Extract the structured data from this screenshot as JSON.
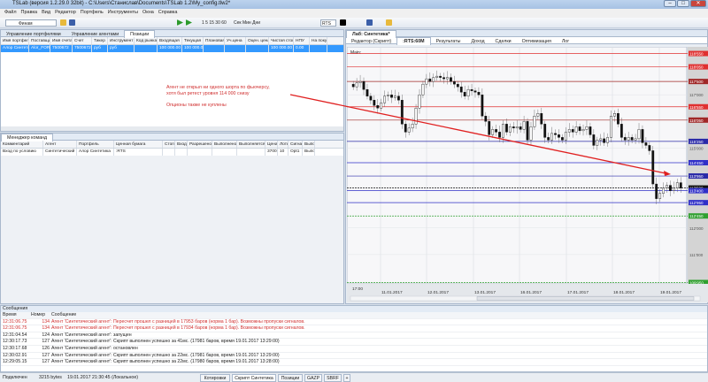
{
  "window": {
    "title": "TSLab (версия 1.2.29.0 32bit) - C:\\Users\\Станислав\\Documents\\TSLab 1.2\\My_config.tlw2*",
    "min": "–",
    "max": "□",
    "close": "✕"
  },
  "menu": [
    "Файл",
    "Правка",
    "Вид",
    "Редактор",
    "Портфель",
    "Инструменты",
    "Окна",
    "Справка"
  ],
  "toolbar": {
    "provider": "Финам",
    "intervals": "1  5  15  30  60",
    "units": "Сек  Мин  Дни",
    "symbol": "RTS"
  },
  "left_tabs": [
    "Управление портфелями",
    "Управление агентами",
    "Позиции"
  ],
  "positions": {
    "columns": [
      "Имя портфеля",
      "Поставщик",
      "Имя счета",
      "Счет",
      "Тикер",
      "Инструмент",
      "Код рынка",
      "Входящая",
      "Текущая",
      "Плановая",
      "Уч.цена",
      "Оцен. цена",
      "Чистая стоим.",
      "НПУ",
      "На покупку"
    ],
    "rows": [
      [
        "Алор Синтетика",
        "Alor_FORTS",
        "7500672",
        "7500672",
        "руб",
        "руб",
        "",
        "100 000.00",
        "100 000.00",
        "",
        "",
        "",
        "100 000.00",
        "0.00",
        ""
      ]
    ]
  },
  "commands": {
    "title": "Менеджер команд",
    "columns": [
      "Комментарий",
      "Агент",
      "Портфель",
      "Ценная бумага",
      "Стоп?",
      "Вход?",
      "Разрешено",
      "Выполнено",
      "Выполняется",
      "Цена",
      "Лоты",
      "Сигнал",
      "Выпо"
    ],
    "rows": [
      [
        "Вход по условию",
        "Синтетический",
        "Алор Синтетика",
        ":RTS",
        "",
        "",
        "",
        "",
        "",
        "3700",
        "10",
        "Opt1",
        "Выпо"
      ]
    ]
  },
  "annotation": {
    "line1": "Агент не открыл ни одного шорта по фьючерсу,",
    "line2": "хотя был ретест уровня 114 000 снизу",
    "line3": "Опционы также не куплены"
  },
  "lab": {
    "tab": "Лаб: Синтетика*",
    "subtabs": [
      "Редактор (Скрипт)",
      ":RTS:60M",
      "Результаты",
      "Доход",
      "Сделки",
      "Оптимизация",
      "Лог"
    ],
    "pane_label": "Main:"
  },
  "chart_data": {
    "type": "candlestick",
    "x_labels": [
      "17:00",
      "11.01.2017",
      "12.01.2017",
      "13.01.2017",
      "16.01.2017",
      "17.01.2017",
      "18.01.2017",
      "19.01.2017"
    ],
    "ylim": [
      109900,
      118800
    ],
    "closes": [
      117300,
      117450,
      117500,
      117200,
      116950,
      116800,
      116600,
      116500,
      116700,
      116950,
      117000,
      116900,
      116950,
      116800,
      115900,
      115600,
      115750,
      115900,
      116500,
      117000,
      117400,
      117600,
      117500,
      117650,
      117700,
      117650,
      117600,
      117650,
      117500,
      117400,
      117300,
      117100,
      116950,
      117200,
      117150,
      117100,
      117000,
      116200,
      116000,
      115500,
      115700,
      115600,
      115400,
      115900,
      115600,
      115800,
      115750,
      115800,
      115700,
      116000,
      115300,
      115800,
      116200,
      116300,
      115900,
      115400,
      115300,
      115550,
      115500,
      115400,
      115300,
      115600,
      115700,
      115600,
      115800,
      115650,
      115700,
      115800,
      115500,
      115100,
      115300,
      115350,
      115200,
      115400,
      116200,
      116300,
      115900,
      115400,
      115300,
      115400,
      115300,
      115350,
      115700,
      115200,
      115100,
      114900,
      113650,
      113100,
      113300,
      113500,
      113600,
      113400,
      113500,
      113700,
      113500
    ],
    "plain_ticks": [
      {
        "label": "117'000",
        "value": 117000
      },
      {
        "label": "115'000",
        "value": 115000
      },
      {
        "label": "112'000",
        "value": 112000
      },
      {
        "label": "111'000",
        "value": 111000
      }
    ],
    "levels": [
      {
        "label": "118'550",
        "value": 118550,
        "color": "#e03030"
      },
      {
        "label": "118'050",
        "value": 118050,
        "color": "#e03030"
      },
      {
        "label": "117'500",
        "value": 117500,
        "color": "#a02828"
      },
      {
        "label": "116'550",
        "value": 116550,
        "color": "#e03030"
      },
      {
        "label": "116'050",
        "value": 116050,
        "color": "#a02828"
      },
      {
        "label": "115'250",
        "value": 115250,
        "color": "#2a2aa8"
      },
      {
        "label": "114'450",
        "value": 114450,
        "color": "#3030c8"
      },
      {
        "label": "113'950",
        "value": 113950,
        "color": "#2a2aa8"
      },
      {
        "label": "113'500",
        "value": 113500,
        "color": "#111111"
      },
      {
        "label": "113'400",
        "value": 113400,
        "color": "#3030c8"
      },
      {
        "label": "112'950",
        "value": 112950,
        "color": "#3030c8"
      },
      {
        "label": "112'450",
        "value": 112450,
        "color": "#30a030"
      },
      {
        "label": "109'950",
        "value": 109950,
        "color": "#30a030"
      }
    ]
  },
  "messages": {
    "title": "Сообщения",
    "columns": [
      "Время",
      "Номер",
      "Сообщение"
    ],
    "rows": [
      {
        "time": "12:31:06.75",
        "num": "134",
        "text": "Агент 'Синтетический агент': Пересчет прошел с разницей в 17953 баров (норма 1 бар). Возможны пропуски сигналов.",
        "error": true
      },
      {
        "time": "12:31:06.75",
        "num": "134",
        "text": "Агент 'Синтетический агент': Пересчет прошел с разницей в 17934 баров (норма 1 бар). Возможны пропуски сигналов.",
        "error": true
      },
      {
        "time": "12:31:04.54",
        "num": "124",
        "text": "Агент 'Синтетический агент': запущен",
        "error": false
      },
      {
        "time": "12:30:17.73",
        "num": "127",
        "text": "Агент 'Синтетический агент': Скрипт выполнен успешно за 41мс. (17981 баров, время 19.01.2017 13:29:00)",
        "error": false
      },
      {
        "time": "12:30:17.68",
        "num": "126",
        "text": "Агент 'Синтетический агент': остановлен",
        "error": false
      },
      {
        "time": "12:30:02.91",
        "num": "127",
        "text": "Агент 'Синтетический агент': Скрипт выполнен успешно за 22мс. (17981 баров, время 19.01.2017 13:29:00)",
        "error": false
      },
      {
        "time": "12:29:05.15",
        "num": "127",
        "text": "Агент 'Синтетический агент': Скрипт выполнен успешно за 22мс. (17980 баров, время 19.01.2017 13:28:00)",
        "error": false
      }
    ]
  },
  "status": {
    "conn": "Подключен",
    "bytes": "3215 bytes",
    "time": "19.01.2017 21:30:45 (Локальное)",
    "tabs": [
      "Котировки",
      "Скрипт Синтетика",
      "Позиции",
      "GAZP",
      "SBRF",
      "+"
    ]
  }
}
